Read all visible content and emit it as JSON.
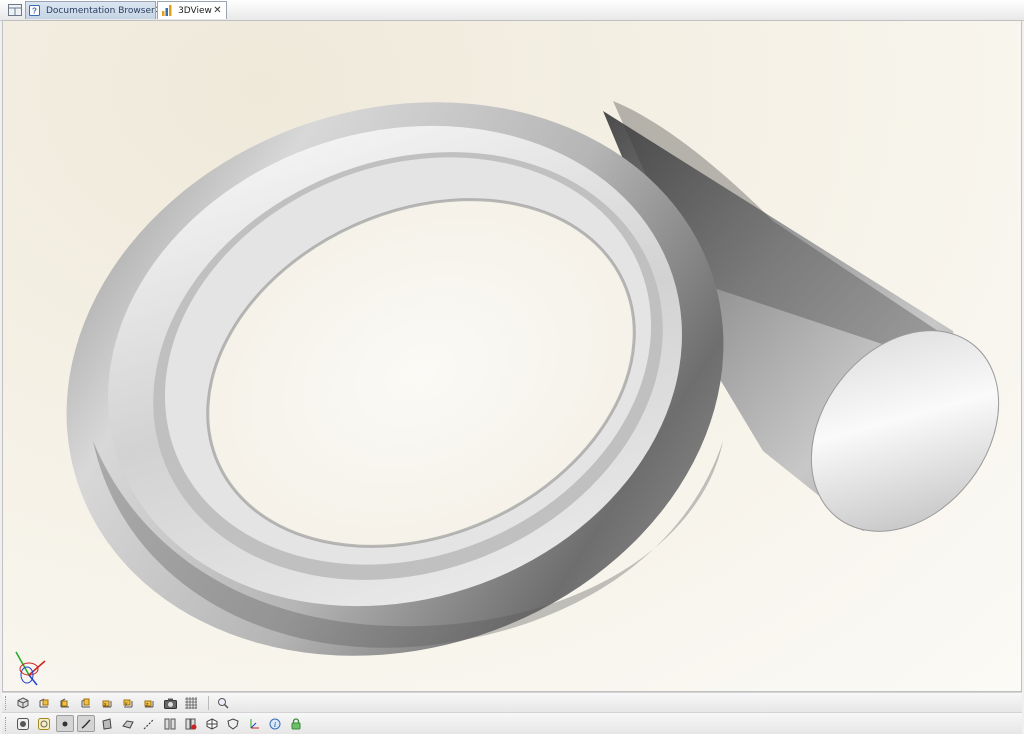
{
  "tabs": [
    {
      "label": "Documentation Browser",
      "icon": "help-icon",
      "close": "✕"
    },
    {
      "label": "3DView",
      "icon": "chart-icon",
      "close": "✕"
    }
  ],
  "viewport": {
    "background_colors": [
      "#efe9da",
      "#fbfaf6"
    ],
    "model": "spiral-volute-pipe",
    "model_color": "#c8c8c8"
  },
  "triad": {
    "x_color": "#cc2222",
    "y_color": "#22aa22",
    "z_color": "#2244cc"
  },
  "toolbar_row1": [
    "view-iso-icon",
    "view-front-icon",
    "view-back-icon",
    "view-left-icon",
    "view-right-icon",
    "view-top-icon",
    "view-bottom-icon",
    "camera-icon",
    "grid-icon",
    "zoom-icon"
  ],
  "toolbar_row2": [
    "display-shaded-icon",
    "display-highlight-icon",
    "selection-point-icon",
    "selection-edge-icon",
    "selection-face-icon",
    "measure-icon",
    "section-x-icon",
    "section-remove-icon",
    "section-box-icon",
    "shield-icon",
    "axis-icon",
    "info-icon",
    "lock-icon"
  ]
}
